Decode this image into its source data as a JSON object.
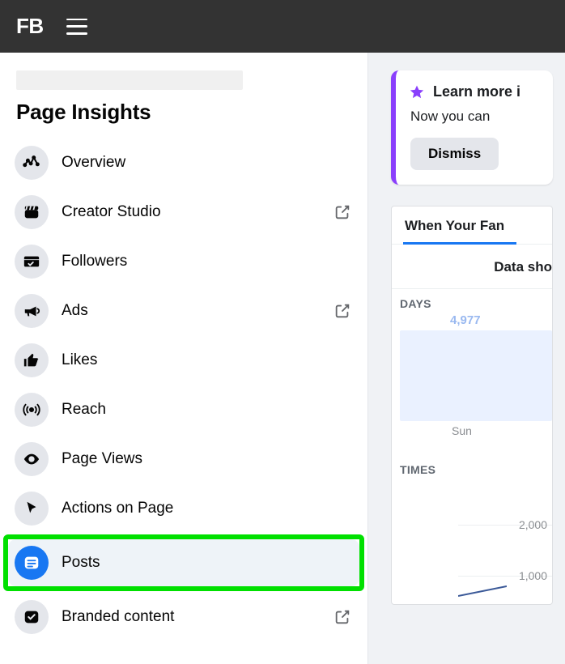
{
  "header": {
    "logo": "FB"
  },
  "sidebar": {
    "title": "Page Insights",
    "items": [
      {
        "id": "overview",
        "label": "Overview",
        "external": false,
        "active": false
      },
      {
        "id": "creator-studio",
        "label": "Creator Studio",
        "external": true,
        "active": false
      },
      {
        "id": "followers",
        "label": "Followers",
        "external": false,
        "active": false
      },
      {
        "id": "ads",
        "label": "Ads",
        "external": true,
        "active": false
      },
      {
        "id": "likes",
        "label": "Likes",
        "external": false,
        "active": false
      },
      {
        "id": "reach",
        "label": "Reach",
        "external": false,
        "active": false
      },
      {
        "id": "page-views",
        "label": "Page Views",
        "external": false,
        "active": false
      },
      {
        "id": "actions",
        "label": "Actions on Page",
        "external": false,
        "active": false
      },
      {
        "id": "posts",
        "label": "Posts",
        "external": false,
        "active": true
      },
      {
        "id": "branded",
        "label": "Branded content",
        "external": true,
        "active": false
      }
    ]
  },
  "notice": {
    "title": "Learn more i",
    "subtitle": "Now you can",
    "dismiss": "Dismiss"
  },
  "fans_card": {
    "tab": "When Your Fan",
    "data_label": "Data sho",
    "days_label": "DAYS",
    "times_label": "TIMES"
  },
  "chart_data": {
    "days": {
      "type": "bar",
      "title": "DAYS",
      "categories": [
        "Sun"
      ],
      "values": [
        4977
      ],
      "bar_label": "4,977",
      "axis_label": "Sun"
    },
    "times": {
      "type": "line",
      "title": "TIMES",
      "yticks": [
        1000,
        2000
      ],
      "ytick_labels": [
        "1,000",
        "2,000"
      ]
    }
  }
}
